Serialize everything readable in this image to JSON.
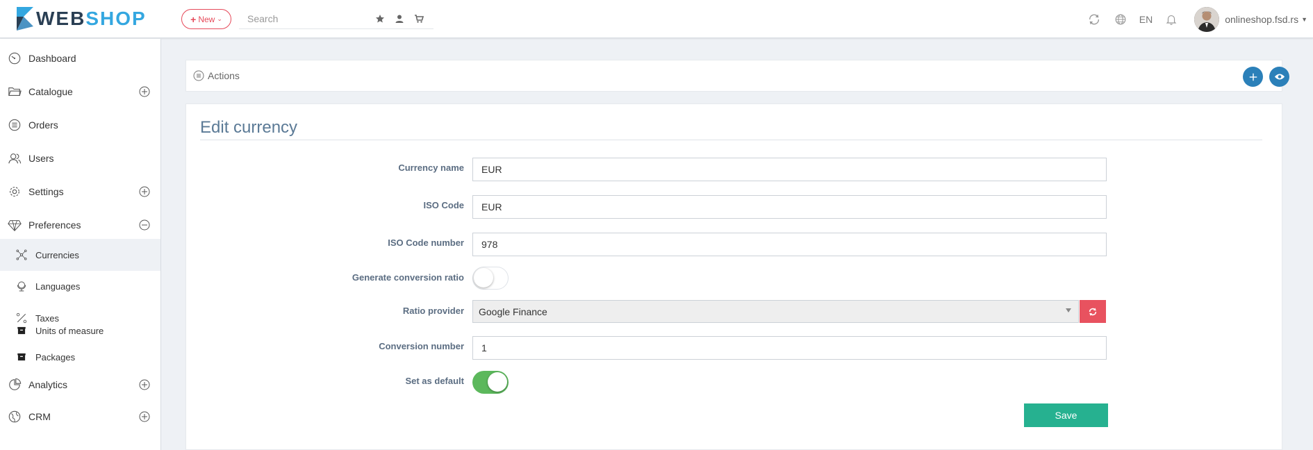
{
  "header": {
    "logo_web": "WEB",
    "logo_shop": "SHOP",
    "new_label": "New",
    "search_placeholder": "Search",
    "lang": "EN",
    "user_name": "onlineshop.fsd.rs"
  },
  "sidebar": {
    "items": [
      {
        "label": "Dashboard",
        "icon": "dashboard-icon"
      },
      {
        "label": "Catalogue",
        "icon": "folder-icon"
      },
      {
        "label": "Orders",
        "icon": "list-icon"
      },
      {
        "label": "Users",
        "icon": "users-icon"
      },
      {
        "label": "Settings",
        "icon": "gear-icon"
      },
      {
        "label": "Preferences",
        "icon": "diamond-icon"
      },
      {
        "label": "Currencies",
        "icon": "network-icon"
      },
      {
        "label": "Languages",
        "icon": "globe-icon"
      },
      {
        "label": "Taxes",
        "icon": "percent-icon"
      },
      {
        "label": "Units of measure",
        "icon": "box-icon"
      },
      {
        "label": "Packages",
        "icon": "box-icon"
      },
      {
        "label": "Analytics",
        "icon": "pie-icon"
      },
      {
        "label": "CRM",
        "icon": "crm-icon"
      }
    ]
  },
  "actions": {
    "label": "Actions"
  },
  "form": {
    "title": "Edit currency",
    "currency_name_label": "Currency name",
    "currency_name_value": "EUR",
    "iso_code_label": "ISO Code",
    "iso_code_value": "EUR",
    "iso_number_label": "ISO Code number",
    "iso_number_value": "978",
    "generate_ratio_label": "Generate conversion ratio",
    "generate_ratio_on": false,
    "ratio_provider_label": "Ratio provider",
    "ratio_provider_value": "Google Finance",
    "conversion_number_label": "Conversion number",
    "conversion_number_value": "1",
    "default_label": "Set as default",
    "default_on": true,
    "save_label": "Save"
  },
  "colors": {
    "accent_blue": "#2b80b9",
    "save_green": "#26b190",
    "danger_red": "#e8525f",
    "switch_on": "#5cb85c"
  }
}
